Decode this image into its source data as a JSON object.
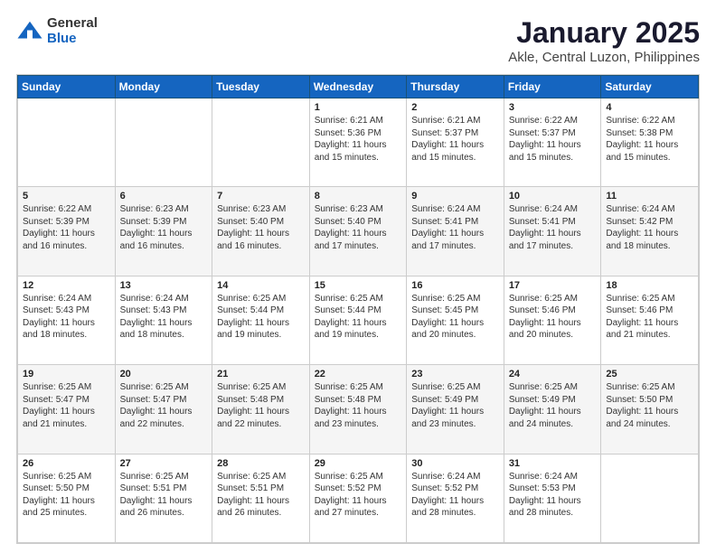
{
  "header": {
    "logo_general": "General",
    "logo_blue": "Blue",
    "title": "January 2025",
    "subtitle": "Akle, Central Luzon, Philippines"
  },
  "days_of_week": [
    "Sunday",
    "Monday",
    "Tuesday",
    "Wednesday",
    "Thursday",
    "Friday",
    "Saturday"
  ],
  "weeks": [
    [
      {
        "day": "",
        "sunrise": "",
        "sunset": "",
        "daylight": ""
      },
      {
        "day": "",
        "sunrise": "",
        "sunset": "",
        "daylight": ""
      },
      {
        "day": "",
        "sunrise": "",
        "sunset": "",
        "daylight": ""
      },
      {
        "day": "1",
        "sunrise": "Sunrise: 6:21 AM",
        "sunset": "Sunset: 5:36 PM",
        "daylight": "Daylight: 11 hours and 15 minutes."
      },
      {
        "day": "2",
        "sunrise": "Sunrise: 6:21 AM",
        "sunset": "Sunset: 5:37 PM",
        "daylight": "Daylight: 11 hours and 15 minutes."
      },
      {
        "day": "3",
        "sunrise": "Sunrise: 6:22 AM",
        "sunset": "Sunset: 5:37 PM",
        "daylight": "Daylight: 11 hours and 15 minutes."
      },
      {
        "day": "4",
        "sunrise": "Sunrise: 6:22 AM",
        "sunset": "Sunset: 5:38 PM",
        "daylight": "Daylight: 11 hours and 15 minutes."
      }
    ],
    [
      {
        "day": "5",
        "sunrise": "Sunrise: 6:22 AM",
        "sunset": "Sunset: 5:39 PM",
        "daylight": "Daylight: 11 hours and 16 minutes."
      },
      {
        "day": "6",
        "sunrise": "Sunrise: 6:23 AM",
        "sunset": "Sunset: 5:39 PM",
        "daylight": "Daylight: 11 hours and 16 minutes."
      },
      {
        "day": "7",
        "sunrise": "Sunrise: 6:23 AM",
        "sunset": "Sunset: 5:40 PM",
        "daylight": "Daylight: 11 hours and 16 minutes."
      },
      {
        "day": "8",
        "sunrise": "Sunrise: 6:23 AM",
        "sunset": "Sunset: 5:40 PM",
        "daylight": "Daylight: 11 hours and 17 minutes."
      },
      {
        "day": "9",
        "sunrise": "Sunrise: 6:24 AM",
        "sunset": "Sunset: 5:41 PM",
        "daylight": "Daylight: 11 hours and 17 minutes."
      },
      {
        "day": "10",
        "sunrise": "Sunrise: 6:24 AM",
        "sunset": "Sunset: 5:41 PM",
        "daylight": "Daylight: 11 hours and 17 minutes."
      },
      {
        "day": "11",
        "sunrise": "Sunrise: 6:24 AM",
        "sunset": "Sunset: 5:42 PM",
        "daylight": "Daylight: 11 hours and 18 minutes."
      }
    ],
    [
      {
        "day": "12",
        "sunrise": "Sunrise: 6:24 AM",
        "sunset": "Sunset: 5:43 PM",
        "daylight": "Daylight: 11 hours and 18 minutes."
      },
      {
        "day": "13",
        "sunrise": "Sunrise: 6:24 AM",
        "sunset": "Sunset: 5:43 PM",
        "daylight": "Daylight: 11 hours and 18 minutes."
      },
      {
        "day": "14",
        "sunrise": "Sunrise: 6:25 AM",
        "sunset": "Sunset: 5:44 PM",
        "daylight": "Daylight: 11 hours and 19 minutes."
      },
      {
        "day": "15",
        "sunrise": "Sunrise: 6:25 AM",
        "sunset": "Sunset: 5:44 PM",
        "daylight": "Daylight: 11 hours and 19 minutes."
      },
      {
        "day": "16",
        "sunrise": "Sunrise: 6:25 AM",
        "sunset": "Sunset: 5:45 PM",
        "daylight": "Daylight: 11 hours and 20 minutes."
      },
      {
        "day": "17",
        "sunrise": "Sunrise: 6:25 AM",
        "sunset": "Sunset: 5:46 PM",
        "daylight": "Daylight: 11 hours and 20 minutes."
      },
      {
        "day": "18",
        "sunrise": "Sunrise: 6:25 AM",
        "sunset": "Sunset: 5:46 PM",
        "daylight": "Daylight: 11 hours and 21 minutes."
      }
    ],
    [
      {
        "day": "19",
        "sunrise": "Sunrise: 6:25 AM",
        "sunset": "Sunset: 5:47 PM",
        "daylight": "Daylight: 11 hours and 21 minutes."
      },
      {
        "day": "20",
        "sunrise": "Sunrise: 6:25 AM",
        "sunset": "Sunset: 5:47 PM",
        "daylight": "Daylight: 11 hours and 22 minutes."
      },
      {
        "day": "21",
        "sunrise": "Sunrise: 6:25 AM",
        "sunset": "Sunset: 5:48 PM",
        "daylight": "Daylight: 11 hours and 22 minutes."
      },
      {
        "day": "22",
        "sunrise": "Sunrise: 6:25 AM",
        "sunset": "Sunset: 5:48 PM",
        "daylight": "Daylight: 11 hours and 23 minutes."
      },
      {
        "day": "23",
        "sunrise": "Sunrise: 6:25 AM",
        "sunset": "Sunset: 5:49 PM",
        "daylight": "Daylight: 11 hours and 23 minutes."
      },
      {
        "day": "24",
        "sunrise": "Sunrise: 6:25 AM",
        "sunset": "Sunset: 5:49 PM",
        "daylight": "Daylight: 11 hours and 24 minutes."
      },
      {
        "day": "25",
        "sunrise": "Sunrise: 6:25 AM",
        "sunset": "Sunset: 5:50 PM",
        "daylight": "Daylight: 11 hours and 24 minutes."
      }
    ],
    [
      {
        "day": "26",
        "sunrise": "Sunrise: 6:25 AM",
        "sunset": "Sunset: 5:50 PM",
        "daylight": "Daylight: 11 hours and 25 minutes."
      },
      {
        "day": "27",
        "sunrise": "Sunrise: 6:25 AM",
        "sunset": "Sunset: 5:51 PM",
        "daylight": "Daylight: 11 hours and 26 minutes."
      },
      {
        "day": "28",
        "sunrise": "Sunrise: 6:25 AM",
        "sunset": "Sunset: 5:51 PM",
        "daylight": "Daylight: 11 hours and 26 minutes."
      },
      {
        "day": "29",
        "sunrise": "Sunrise: 6:25 AM",
        "sunset": "Sunset: 5:52 PM",
        "daylight": "Daylight: 11 hours and 27 minutes."
      },
      {
        "day": "30",
        "sunrise": "Sunrise: 6:24 AM",
        "sunset": "Sunset: 5:52 PM",
        "daylight": "Daylight: 11 hours and 28 minutes."
      },
      {
        "day": "31",
        "sunrise": "Sunrise: 6:24 AM",
        "sunset": "Sunset: 5:53 PM",
        "daylight": "Daylight: 11 hours and 28 minutes."
      },
      {
        "day": "",
        "sunrise": "",
        "sunset": "",
        "daylight": ""
      }
    ]
  ]
}
